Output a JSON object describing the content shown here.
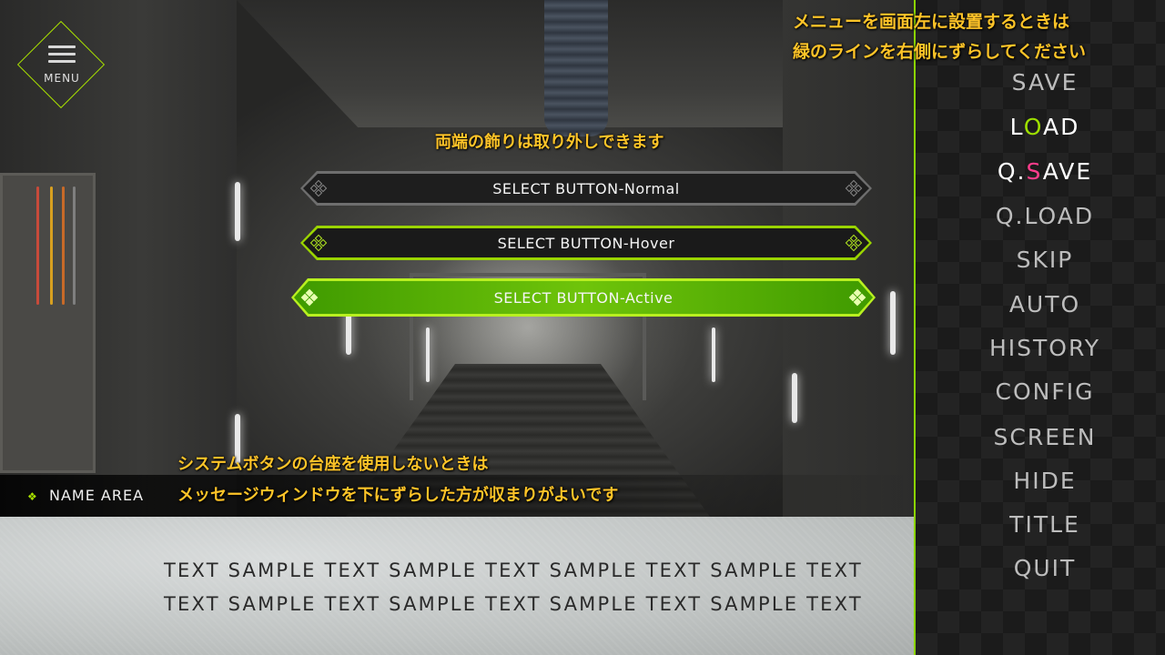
{
  "menu_button": {
    "label": "MENU"
  },
  "annotations": {
    "top_line1": "メニューを画面左に設置するときは",
    "top_line2": "緑のラインを右側にずらしてください",
    "middle": "両端の飾りは取り外しできます",
    "bottom_line1": "システムボタンの台座を使用しないときは",
    "bottom_line2": "メッセージウィンドウを下にずらした方が収まりがよいです"
  },
  "select_buttons": {
    "normal": "SELECT BUTTON-Normal",
    "hover": "SELECT BUTTON-Hover",
    "active": "SELECT BUTTON-Active"
  },
  "name_area": {
    "label": "NAME AREA"
  },
  "message": {
    "line1": "TEXT SAMPLE TEXT SAMPLE TEXT SAMPLE TEXT SAMPLE TEXT",
    "line2": "TEXT SAMPLE TEXT SAMPLE TEXT SAMPLE TEXT SAMPLE TEXT"
  },
  "system_menu": {
    "save": "SAVE",
    "load": {
      "pre": "L",
      "accent": "O",
      "post": "AD"
    },
    "qsave": {
      "pre": "Q.",
      "accent": "S",
      "post": "AVE"
    },
    "qload": "Q.LOAD",
    "skip": "SKIP",
    "auto": "AUTO",
    "history": "HISTORY",
    "config": "CONFIG",
    "screen": "SCREEN",
    "hide": "HIDE",
    "title": "TITLE",
    "quit": "QUIT"
  },
  "colors": {
    "accent_green": "#9ee000",
    "accent_pink": "#ff3d8c",
    "annotation_yellow": "#ffc428"
  }
}
